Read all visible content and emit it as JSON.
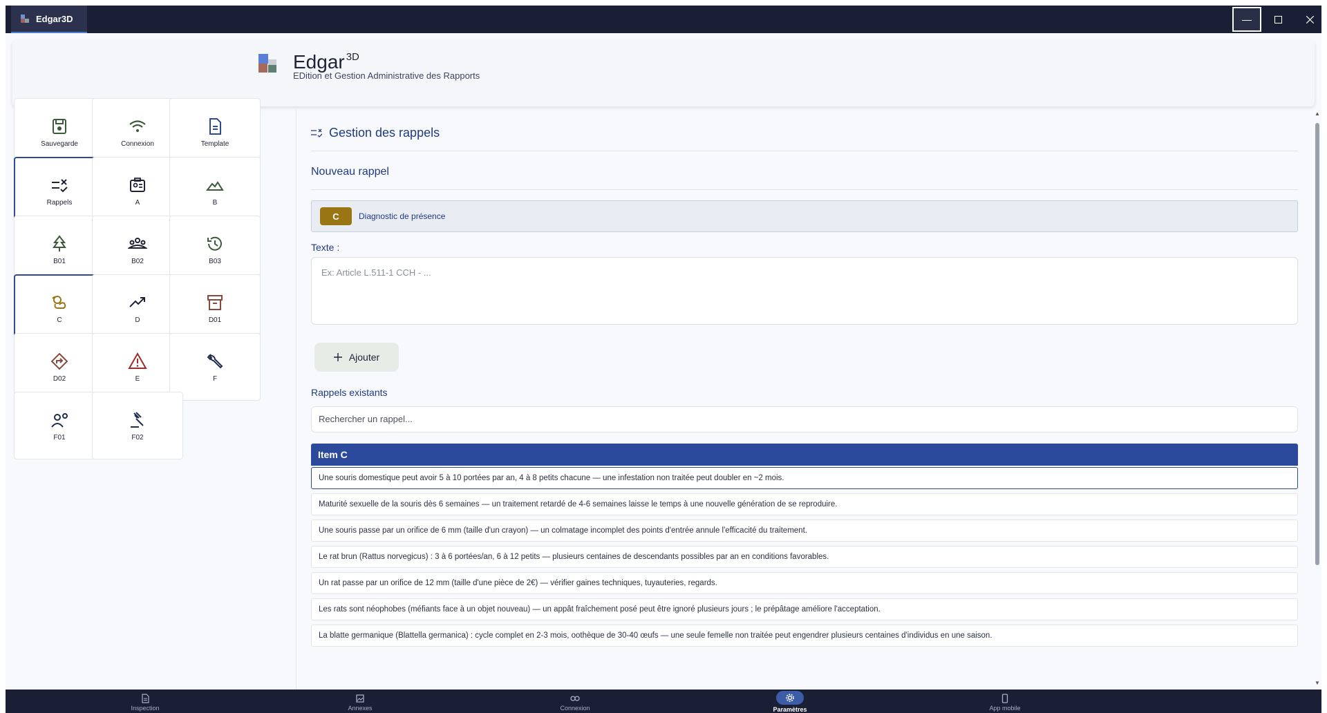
{
  "window": {
    "tab_title": "Edgar3D",
    "controls": {
      "minimize": "minimize-icon",
      "maximize": "maximize-icon",
      "close": "close-icon"
    }
  },
  "header": {
    "app_name": "Edgar",
    "app_superscript": "3D",
    "subtitle": "EDition et Gestion Administrative des Rapports"
  },
  "tiles": [
    {
      "label": "Sauvegarde",
      "icon": "save-icon",
      "active": false
    },
    {
      "label": "Connexion",
      "icon": "wifi-icon",
      "active": false
    },
    {
      "label": "Template",
      "icon": "document-icon",
      "active": false
    },
    {
      "label": "Rappels",
      "icon": "rule-icon",
      "active": true
    },
    {
      "label": "A",
      "icon": "id-card-icon",
      "active": false
    },
    {
      "label": "B",
      "icon": "landscape-icon",
      "active": false
    },
    {
      "label": "B01",
      "icon": "tree-icon",
      "active": false
    },
    {
      "label": "B02",
      "icon": "group-icon",
      "active": false
    },
    {
      "label": "B03",
      "icon": "history-icon",
      "active": false
    },
    {
      "label": "C",
      "icon": "pest-icon",
      "active": true
    },
    {
      "label": "D",
      "icon": "trending-up-icon",
      "active": false
    },
    {
      "label": "D01",
      "icon": "archive-icon",
      "active": false
    },
    {
      "label": "D02",
      "icon": "diamond-direction-icon",
      "active": false
    },
    {
      "label": "E",
      "icon": "warning-icon",
      "active": false
    },
    {
      "label": "F",
      "icon": "wrench-icon",
      "active": false
    },
    {
      "label": "F01",
      "icon": "person-settings-icon",
      "active": false
    },
    {
      "label": "F02",
      "icon": "gavel-icon",
      "active": false
    }
  ],
  "main": {
    "section_title": "Gestion des rappels",
    "new_title": "Nouveau rappel",
    "category_code": "C",
    "category_name": "Diagnostic de présence",
    "category_color": "#9a7514",
    "text_label": "Texte :",
    "text_placeholder": "Ex: Article L.511-1 CCH - ...",
    "add_label": "Ajouter",
    "existing_label": "Rappels existants",
    "search_placeholder": "Rechercher un rappel...",
    "group_title": "Item C",
    "rows": [
      "Une souris domestique peut avoir 5 à 10 portées par an, 4 à 8 petits chacune — une infestation non traitée peut doubler en ~2 mois.",
      "Maturité sexuelle de la souris dès 6 semaines — un traitement retardé de 4-6 semaines laisse le temps à une nouvelle génération de se reproduire.",
      "Une souris passe par un orifice de 6 mm (taille d'un crayon) — un colmatage incomplet des points d'entrée annule l'efficacité du traitement.",
      "Le rat brun (Rattus norvegicus) : 3 à 6 portées/an, 6 à 12 petits — plusieurs centaines de descendants possibles par an en conditions favorables.",
      "Un rat passe par un orifice de 12 mm (taille d'une pièce de 2€) — vérifier gaines techniques, tuyauteries, regards.",
      "Les rats sont néophobes (méfiants face à un objet nouveau) — un appât fraîchement posé peut être ignoré plusieurs jours ; le prépâtage améliore l'acceptation.",
      "La blatte germanique (Blattella germanica) : cycle complet en 2-3 mois, oothèque de 30-40 œufs — une seule femelle non traitée peut engendrer plusieurs centaines d'individus en une saison."
    ]
  },
  "bottom_nav": [
    {
      "label": "Inspection",
      "icon": "document-icon",
      "active": false
    },
    {
      "label": "Annexes",
      "icon": "image-icon",
      "active": false
    },
    {
      "label": "Connexion",
      "icon": "link-icon",
      "active": false
    },
    {
      "label": "Paramètres",
      "icon": "gear-icon",
      "active": true
    },
    {
      "label": "App mobile",
      "icon": "phone-icon",
      "active": false
    }
  ],
  "colors": {
    "accent": "#2b4a9b",
    "titlebar": "#1b1f36",
    "icon_green": "#3b5a3a",
    "icon_gold": "#9a7514",
    "icon_red": "#9b2c2c"
  }
}
